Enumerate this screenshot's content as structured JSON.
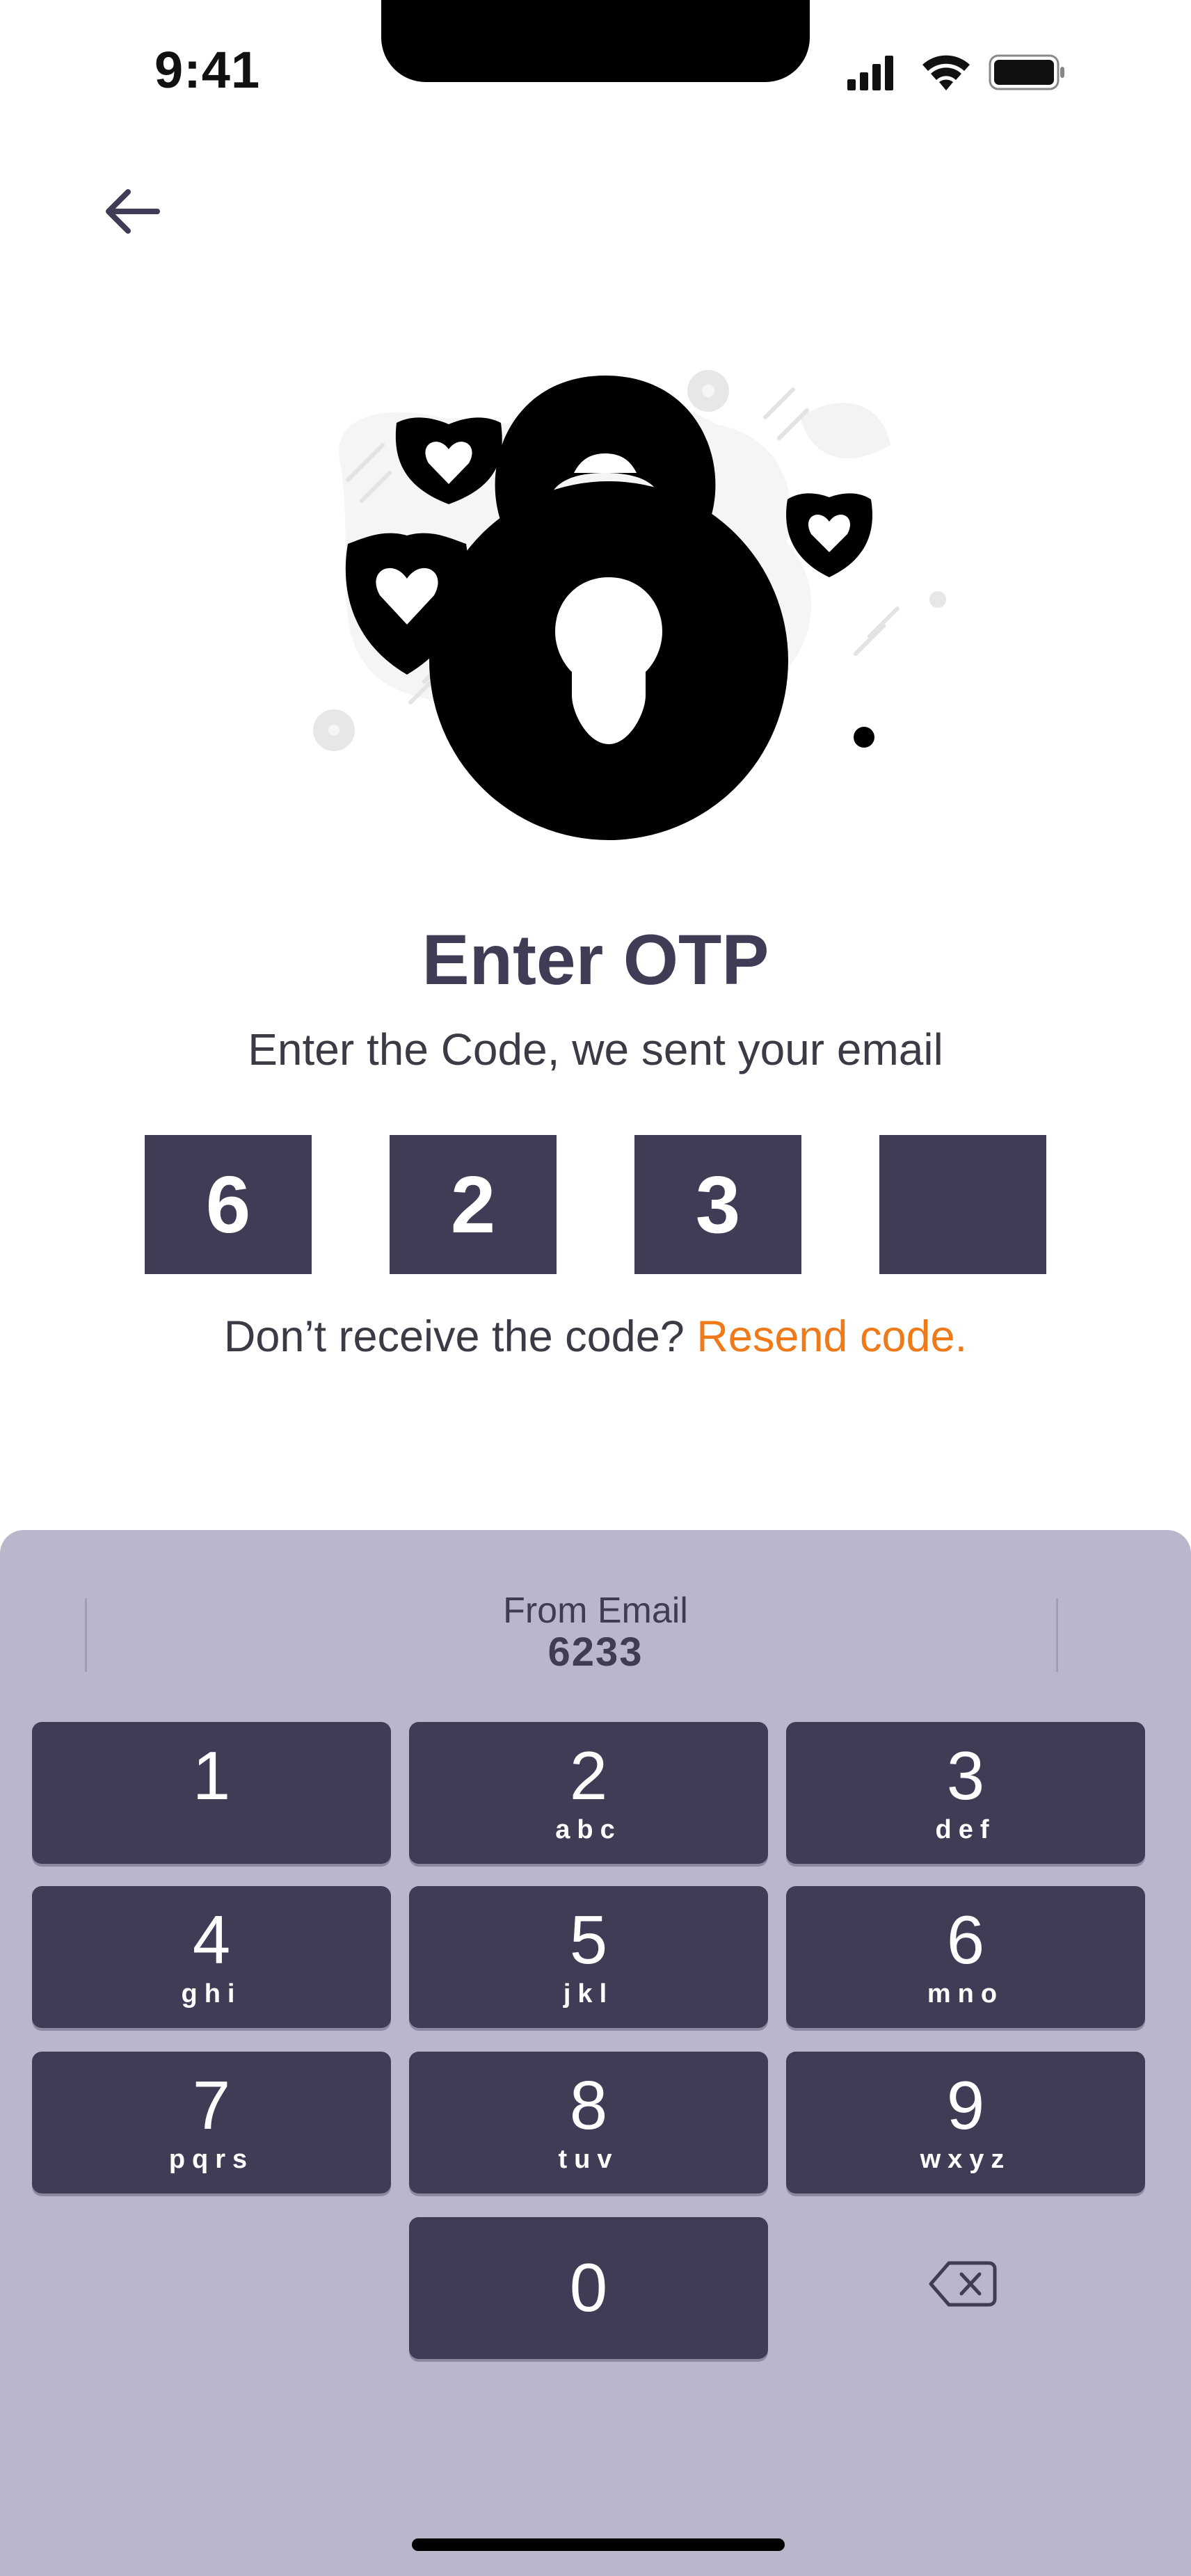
{
  "status_bar": {
    "time": "9:41",
    "icons": [
      "signal-icon",
      "wifi-icon",
      "battery-icon"
    ]
  },
  "header": {
    "back_icon": "arrow-left-icon"
  },
  "content": {
    "title": "Enter OTP",
    "subtitle": "Enter the Code, we sent your email",
    "otp_digits": [
      "6",
      "2",
      "3",
      ""
    ],
    "resend_prompt": "Don’t receive the code?",
    "resend_link": "Resend code."
  },
  "keyboard": {
    "suggestion_title": "From Email",
    "suggestion_code": "6233",
    "keys": [
      {
        "num": "1",
        "letters": ""
      },
      {
        "num": "2",
        "letters": "abc"
      },
      {
        "num": "3",
        "letters": "def"
      },
      {
        "num": "4",
        "letters": "ghi"
      },
      {
        "num": "5",
        "letters": "jkl"
      },
      {
        "num": "6",
        "letters": "mno"
      },
      {
        "num": "7",
        "letters": "pqrs"
      },
      {
        "num": "8",
        "letters": "tuv"
      },
      {
        "num": "9",
        "letters": "wxyz"
      },
      {
        "num": "0",
        "letters": ""
      }
    ],
    "delete_icon": "backspace-icon"
  },
  "colors": {
    "primary": "#3f3c55",
    "accent": "#f07a1a",
    "keyboard_bg": "#b9b7cc"
  }
}
